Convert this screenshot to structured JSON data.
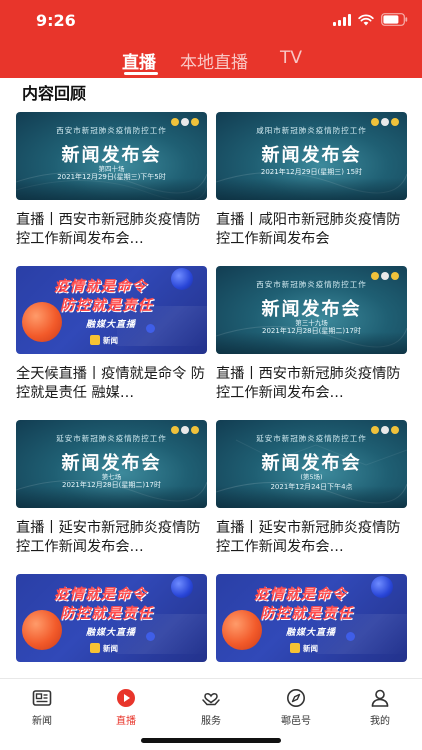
{
  "status_bar": {
    "time": "9:26"
  },
  "tabs": [
    {
      "label": "直播",
      "active": true
    },
    {
      "label": "本地直播",
      "active": false
    },
    {
      "label": "TV",
      "active": false
    }
  ],
  "section_title": "内容回顾",
  "colors": {
    "brand_red": "#e8352b",
    "conf_teal": "#1f5f73",
    "camp_blue": "#3149b8"
  },
  "cards": [
    {
      "type": "conference",
      "thumb": {
        "org": "西安市新冠肺炎疫情防控工作",
        "main": "新闻发布会",
        "session": "第四十场",
        "date": "2021年12月29日(星期三)下午5时"
      },
      "title": "直播丨西安市新冠肺炎疫情防控工作新闻发布会…"
    },
    {
      "type": "conference",
      "thumb": {
        "org": "咸阳市新冠肺炎疫情防控工作",
        "main": "新闻发布会",
        "session": "",
        "date": "2021年12月29日(星期三) 15时"
      },
      "title": "直播丨咸阳市新冠肺炎疫情防控工作新闻发布会"
    },
    {
      "type": "campaign",
      "thumb": {
        "slogan1": "疫情就是命令",
        "slogan2": "防控就是责任",
        "media": "融媒大直播",
        "logo": "新闻"
      },
      "title": "全天候直播丨疫情就是命令 防控就是责任 融媒…"
    },
    {
      "type": "conference",
      "thumb": {
        "org": "西安市新冠肺炎疫情防控工作",
        "main": "新闻发布会",
        "session": "第三十九场",
        "date": "2021年12月28日(星期二)17时"
      },
      "title": "直播丨西安市新冠肺炎疫情防控工作新闻发布会…"
    },
    {
      "type": "conference",
      "thumb": {
        "org": "延安市新冠肺炎疫情防控工作",
        "main": "新闻发布会",
        "session": "第七场",
        "date": "2021年12月28日(星期二)17时"
      },
      "title": "直播丨延安市新冠肺炎疫情防控工作新闻发布会…"
    },
    {
      "type": "conference",
      "thumb": {
        "org": "延安市新冠肺炎疫情防控工作",
        "main": "新闻发布会",
        "session": "(第5场)",
        "date": "2021年12月24日下午4点"
      },
      "title": "直播丨延安市新冠肺炎疫情防控工作新闻发布会…"
    },
    {
      "type": "campaign",
      "thumb": {
        "slogan1": "疫情就是命令",
        "slogan2": "防控就是责任",
        "media": "融媒大直播",
        "logo": "新闻"
      },
      "title": ""
    },
    {
      "type": "campaign",
      "thumb": {
        "slogan1": "疫情就是命令",
        "slogan2": "防控就是责任",
        "media": "融媒大直播",
        "logo": "新闻"
      },
      "title": ""
    }
  ],
  "bottom_nav": [
    {
      "label": "新闻",
      "icon": "news-icon",
      "active": false
    },
    {
      "label": "直播",
      "icon": "live-play-icon",
      "active": true
    },
    {
      "label": "服务",
      "icon": "service-hands-icon",
      "active": false
    },
    {
      "label": "鄠邑号",
      "icon": "compass-icon",
      "active": false
    },
    {
      "label": "我的",
      "icon": "profile-icon",
      "active": false
    }
  ]
}
